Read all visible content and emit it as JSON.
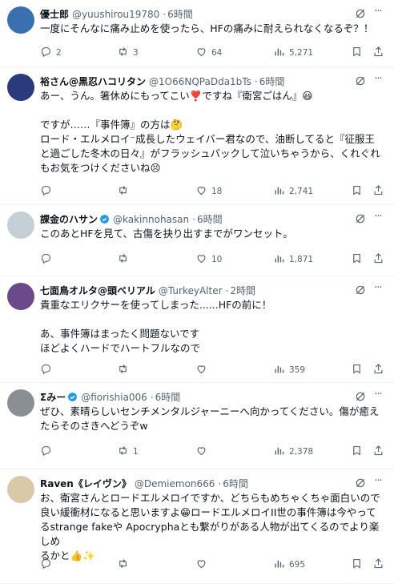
{
  "replies": [
    {
      "name": "優士郎",
      "handle": "@yuushirou19780",
      "time": "6時間",
      "lines": [
        "一度にそんなに痛み止めを使ったら、HFの痛みに耐えられなくなるぞ？！"
      ],
      "replies": "2",
      "retweets": "3",
      "likes": "64",
      "views": "5,271",
      "avatar_color": "#3a6fb0",
      "verified": false
    },
    {
      "name": "裕さん@黒忍ハコリタン",
      "handle": "@1O66NQPaDda1bTs",
      "time": "6時間",
      "lines": [
        "あー、うん。箸休めにもってこい❣️ですね『衛宮ごはん』😃",
        "",
        "ですが……『事件簿』の方は🤔",
        "ロード・エルメロイ⁻成長したウェイバー君なので、油断してると『征服王",
        "と過ごした冬木の日々』がフラッシュバックして泣いちゃうから、くれぐれ",
        "もお気をつけくださいね😣"
      ],
      "replies": "",
      "retweets": "",
      "likes": "18",
      "views": "2,741",
      "avatar_color": "#2a3a7a",
      "verified": false
    },
    {
      "name": "課金のハサン",
      "handle": "@kakinnohasan",
      "time": "6時間",
      "lines": [
        "このあとHFを見て、古傷を抉り出すまでがワンセット。"
      ],
      "replies": "",
      "retweets": "",
      "likes": "10",
      "views": "1,871",
      "avatar_color": "#c4cfd6",
      "verified": true
    },
    {
      "name": "七面鳥オルタ@頭ベリアル",
      "handle": "@TurkeyAlter",
      "time": "2時間",
      "lines": [
        "貴重なエリクサーを使ってしまった......HFの前に！",
        "",
        "あ、事件簿はまったく問題ないです",
        "ほどよくハードでハートフルなので"
      ],
      "replies": "",
      "retweets": "",
      "likes": "",
      "views": "359",
      "avatar_color": "#6a4a8a",
      "verified": false
    },
    {
      "name": "Σみー",
      "handle": "@fiorishia006",
      "time": "6時間",
      "lines": [
        "ぜひ、素晴らしいセンチメンタルジャーニーへ向かってください。傷が癒え",
        "たらそのさきへどうぞw"
      ],
      "replies": "",
      "retweets": "1",
      "likes": "",
      "views": "2,378",
      "avatar_color": "#8a8f94",
      "verified": true
    },
    {
      "name": "Raven《レイヴン》",
      "handle": "@Demiemon666",
      "time": "6時間",
      "lines": [
        "お、衛宮さんとロードエルメロイですか、どちらもめちゃくちゃ面白いので",
        "良い緩衝材になると思いますよ😁ロードエルメロイII世の事件簿は今やって",
        "るstrange fakeや Apocryphaとも繋がりがある人物が出てくるのでより楽しめ",
        "るかと👍✨"
      ],
      "replies": "",
      "retweets": "",
      "likes": "",
      "views": "695",
      "avatar_color": "#d9c9a8",
      "verified": false
    }
  ]
}
